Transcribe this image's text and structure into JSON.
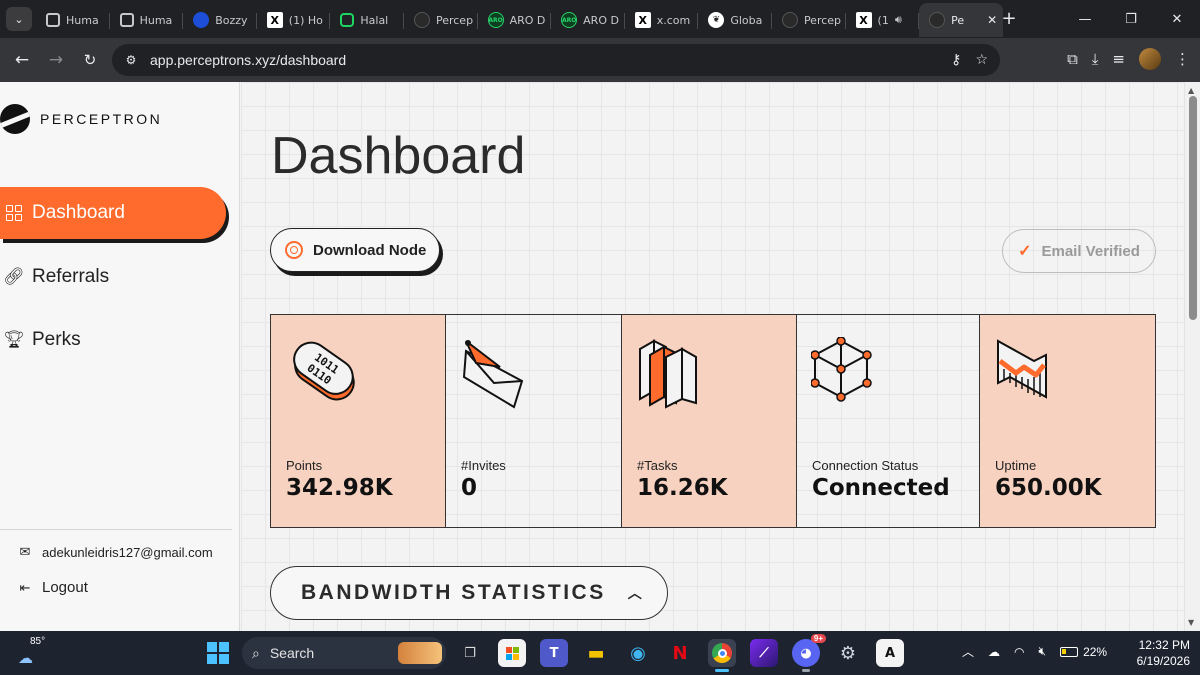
{
  "browser": {
    "tabs": [
      {
        "title": "Huma",
        "favicon": "hexagon-icon"
      },
      {
        "title": "Huma",
        "favicon": "hexagon-icon"
      },
      {
        "title": "Bozzy",
        "favicon": "bozzy-icon"
      },
      {
        "title": "(1) Ho",
        "favicon": "x-icon"
      },
      {
        "title": "Halal",
        "favicon": "hexagon-green-icon"
      },
      {
        "title": "Percep",
        "favicon": "perceptron-icon"
      },
      {
        "title": "ARO D",
        "favicon": "aro-icon"
      },
      {
        "title": "ARO D",
        "favicon": "aro-icon"
      },
      {
        "title": "x.com",
        "favicon": "x-icon"
      },
      {
        "title": "Globa",
        "favicon": "leaf-icon"
      },
      {
        "title": "Percep",
        "favicon": "perceptron-icon"
      },
      {
        "title": "(1",
        "favicon": "x-icon"
      }
    ],
    "active_tab": {
      "title": "Pe",
      "favicon": "perceptron-icon"
    },
    "url": "app.perceptrons.xyz/dashboard"
  },
  "sidebar": {
    "brand": "PERCEPTRON",
    "nav": [
      {
        "label": "Dashboard",
        "icon": "grid-icon",
        "active": true
      },
      {
        "label": "Referrals",
        "icon": "link-icon",
        "active": false
      },
      {
        "label": "Perks",
        "icon": "trophy-icon",
        "active": false
      }
    ],
    "email": "adekunleidris127@gmail.com",
    "logout_label": "Logout"
  },
  "main": {
    "title": "Dashboard",
    "download_label": "Download Node",
    "verified_label": "Email Verified",
    "stats": [
      {
        "label": "Points",
        "value": "342.98K",
        "icon": "binary-capsule-icon",
        "highlight": true
      },
      {
        "label": "#Invites",
        "value": "0",
        "icon": "envelope-icon",
        "highlight": false
      },
      {
        "label": "#Tasks",
        "value": "16.26K",
        "icon": "books-icon",
        "highlight": true
      },
      {
        "label": "Connection Status",
        "value": "Connected",
        "icon": "cube-network-icon",
        "highlight": false
      },
      {
        "label": "Uptime",
        "value": "650.00K",
        "icon": "uptime-chart-icon",
        "highlight": true
      }
    ],
    "bandwidth_label": "BANDWIDTH STATISTICS"
  },
  "taskbar": {
    "temperature": "85°",
    "search_placeholder": "Search",
    "battery": "22%",
    "time": "12:32 PM",
    "date": "6/19/2026",
    "discord_badge": "9+"
  },
  "colors": {
    "accent": "#ff6b2c",
    "card_highlight": "#f7d2c0",
    "page_bg": "#f3f3f3"
  }
}
